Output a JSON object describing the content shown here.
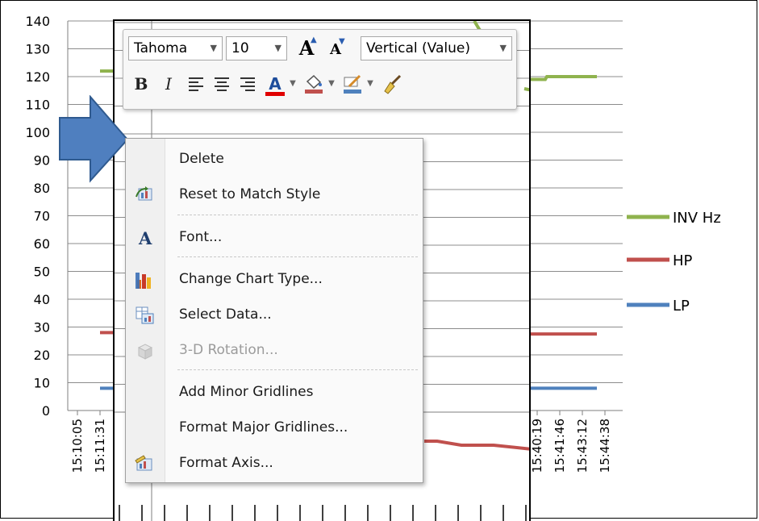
{
  "chart": {
    "y_ticks": [
      "140",
      "130",
      "120",
      "110",
      "100",
      "90",
      "80",
      "70",
      "60",
      "50",
      "40",
      "30",
      "20",
      "10",
      "0"
    ],
    "x_ticks_left": [
      "15:10:05",
      "15:11:31"
    ],
    "x_ticks_right": [
      "15:40:19",
      "15:41:46",
      "15:43:12",
      "15:44:38"
    ],
    "legend": [
      {
        "name": "INV Hz",
        "color": "#8fb34e"
      },
      {
        "name": "HP",
        "color": "#c0504d"
      },
      {
        "name": "LP",
        "color": "#4f81bd"
      }
    ],
    "levels": {
      "inv_hz": 120,
      "hp": 27,
      "lp": 8
    }
  },
  "toolbar": {
    "font_name": "Tahoma",
    "font_size": "10",
    "grow_font": "A",
    "shrink_font": "A",
    "element_selector": "Vertical (Value)",
    "bold": "B",
    "italic": "I",
    "font_color_letter": "A"
  },
  "menu": {
    "items": [
      {
        "label": "Delete",
        "icon": "none",
        "disabled": false
      },
      {
        "label": "Reset to Match Style",
        "icon": "reset-style-icon",
        "disabled": false
      },
      {
        "label": "Font...",
        "icon": "font-icon",
        "disabled": false
      },
      {
        "label": "Change Chart Type...",
        "icon": "chart-type-icon",
        "disabled": false
      },
      {
        "label": "Select Data...",
        "icon": "select-data-icon",
        "disabled": false
      },
      {
        "label": "3-D Rotation...",
        "icon": "3d-rotation-icon",
        "disabled": true
      },
      {
        "label": "Add Minor Gridlines",
        "icon": "none",
        "disabled": false
      },
      {
        "label": "Format Major Gridlines...",
        "icon": "none",
        "disabled": false
      },
      {
        "label": "Format Axis...",
        "icon": "format-axis-icon",
        "disabled": false
      }
    ]
  },
  "colors": {
    "arrow": "#4f7fbf",
    "arrow_outline": "#2f5a8f"
  }
}
